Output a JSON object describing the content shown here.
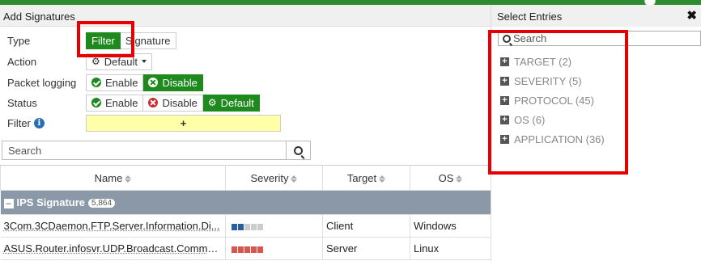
{
  "left_panel": {
    "title": "Add Signatures",
    "type": {
      "label": "Type",
      "options": [
        "Filter",
        "Signature"
      ],
      "selected": "Filter"
    },
    "action": {
      "label": "Action",
      "value": "Default"
    },
    "packet_logging": {
      "label": "Packet logging",
      "options": [
        "Enable",
        "Disable"
      ],
      "selected": "Disable"
    },
    "status": {
      "label": "Status",
      "options": [
        "Enable",
        "Disable",
        "Default"
      ],
      "selected": "Default"
    },
    "filter": {
      "label": "Filter",
      "add_symbol": "+"
    },
    "search": {
      "placeholder": "Search"
    },
    "table": {
      "columns": [
        "Name",
        "Severity",
        "Target",
        "OS"
      ],
      "group": {
        "label": "IPS Signature",
        "count": "5,864"
      },
      "rows": [
        {
          "name": "3Com.3CDaemon.FTP.Server.Information.Di...",
          "severity_level": 2,
          "severity_color": "#2a5d9b",
          "target": "Client",
          "os": "Windows"
        },
        {
          "name": "ASUS.Router.infosvr.UDP.Broadcast.Comma...",
          "severity_level": 5,
          "severity_color": "#d9534f",
          "target": "Server",
          "os": "Linux"
        }
      ]
    }
  },
  "right_panel": {
    "title": "Select Entries",
    "search_placeholder": "Search",
    "entries": [
      "TARGET (2)",
      "SEVERITY (5)",
      "PROTOCOL (45)",
      "OS (6)",
      "APPLICATION (36)"
    ]
  },
  "colors": {
    "accent_green": "#1e8a1e",
    "highlight_red": "#e60000",
    "group_row": "#8a98a8"
  }
}
